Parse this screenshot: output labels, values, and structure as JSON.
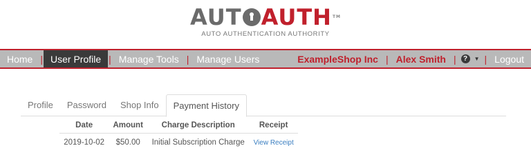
{
  "logo": {
    "part1": "AUT",
    "part2": "AUTH",
    "tm": "TM",
    "tagline": "AUTO AUTHENTICATION AUTHORITY",
    "colors": {
      "gray": "#6b6b6b",
      "red": "#c0202c"
    }
  },
  "navbar": {
    "left": [
      {
        "label": "Home"
      },
      {
        "label": "User Profile",
        "active": true
      },
      {
        "label": "Manage Tools"
      },
      {
        "label": "Manage Users"
      }
    ],
    "separator": "|",
    "company": "ExampleShop Inc",
    "user": "Alex Smith",
    "help_icon": "?",
    "logout": "Logout"
  },
  "tabs": [
    {
      "label": "Profile"
    },
    {
      "label": "Password"
    },
    {
      "label": "Shop Info"
    },
    {
      "label": "Payment History",
      "active": true
    }
  ],
  "payments": {
    "columns": [
      "Date",
      "Amount",
      "Charge Description",
      "Receipt"
    ],
    "rows": [
      {
        "date": "2019-10-02",
        "amount": "$50.00",
        "description": "Initial Subscription Charge",
        "receipt": "View Receipt"
      }
    ]
  }
}
